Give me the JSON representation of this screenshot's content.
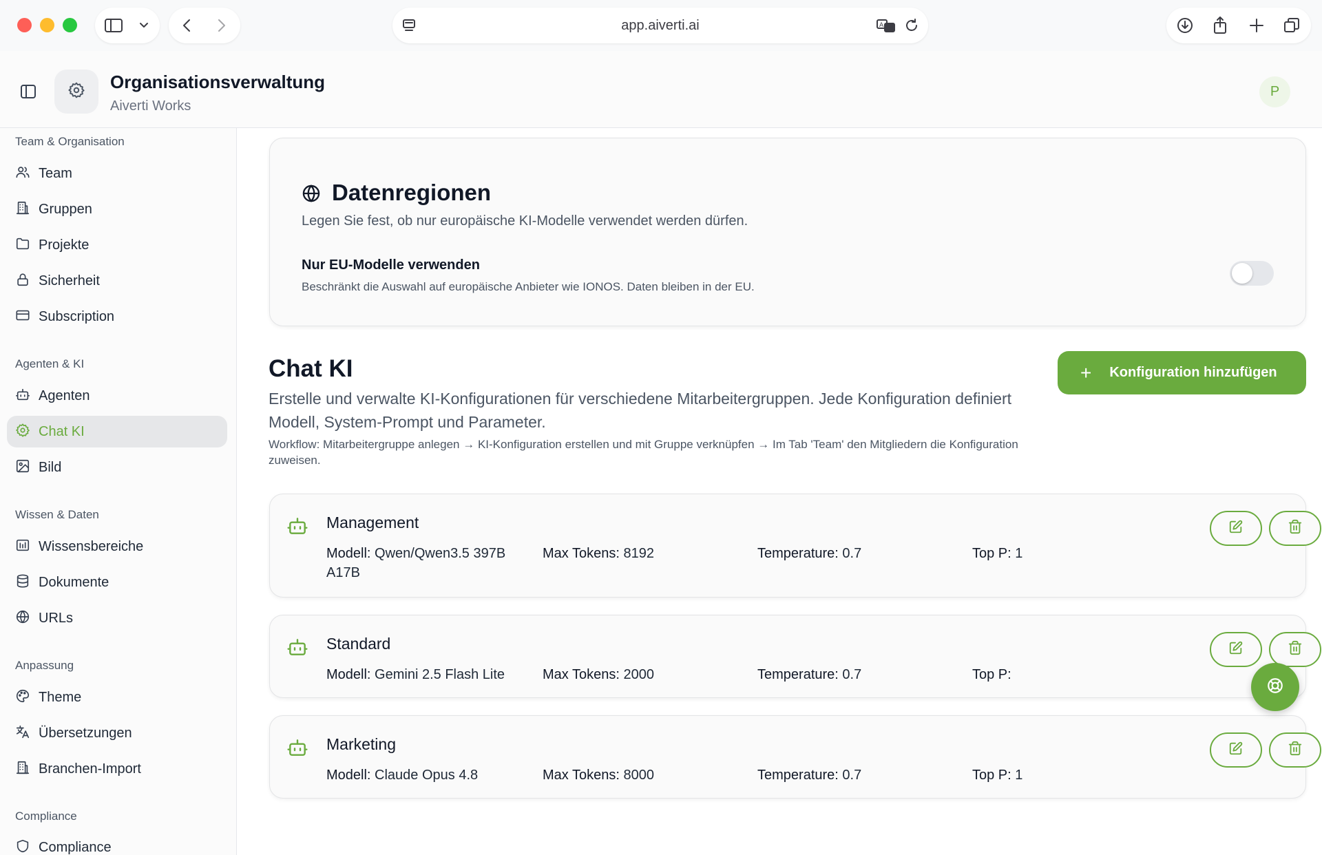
{
  "browser": {
    "url": "app.aiverti.ai"
  },
  "header": {
    "title": "Organisationsverwaltung",
    "subtitle": "Aiverti Works",
    "avatar_initial": "P"
  },
  "sidebar": {
    "sections": [
      {
        "label": "Team & Organisation"
      },
      {
        "label": "Agenten & KI"
      },
      {
        "label": "Wissen & Daten"
      },
      {
        "label": "Anpassung"
      },
      {
        "label": "Compliance"
      }
    ],
    "items": [
      {
        "label": "Team",
        "icon": "users-icon"
      },
      {
        "label": "Gruppen",
        "icon": "building-icon"
      },
      {
        "label": "Projekte",
        "icon": "folder-icon"
      },
      {
        "label": "Sicherheit",
        "icon": "lock-icon"
      },
      {
        "label": "Subscription",
        "icon": "credit-card-icon"
      },
      {
        "label": "Agenten",
        "icon": "bot-icon"
      },
      {
        "label": "Chat KI",
        "icon": "gear-icon",
        "active": true
      },
      {
        "label": "Bild",
        "icon": "image-icon"
      },
      {
        "label": "Wissensbereiche",
        "icon": "library-icon"
      },
      {
        "label": "Dokumente",
        "icon": "database-icon"
      },
      {
        "label": "URLs",
        "icon": "globe-icon"
      },
      {
        "label": "Theme",
        "icon": "palette-icon"
      },
      {
        "label": "Übersetzungen",
        "icon": "translate-icon"
      },
      {
        "label": "Branchen-Import",
        "icon": "building-icon"
      },
      {
        "label": "Compliance",
        "icon": "shield-icon"
      }
    ]
  },
  "data_regions": {
    "title": "Datenregionen",
    "description": "Legen Sie fest, ob nur europäische KI-Modelle verwendet werden dürfen.",
    "option_title": "Nur EU-Modelle verwenden",
    "option_description": "Beschränkt die Auswahl auf europäische Anbieter wie IONOS. Daten bleiben in der EU.",
    "eu_only_enabled": false
  },
  "chat_ki": {
    "title": "Chat KI",
    "description": "Erstelle und verwalte KI-Konfigurationen für verschiedene Mitarbeitergruppen. Jede Konfiguration definiert Modell, System-Prompt und Parameter.",
    "workflow": "Workflow: Mitarbeitergruppe anlegen → KI-Konfiguration erstellen und mit Gruppe verknüpfen → Im Tab 'Team' den Mitgliedern die Konfiguration zuweisen.",
    "add_button": "Konfiguration hinzufügen",
    "labels": {
      "model": "Modell:",
      "max_tokens": "Max Tokens:",
      "temperature": "Temperature:",
      "top_p": "Top P:"
    },
    "configs": [
      {
        "name": "Management",
        "model": "Qwen/Qwen3.5 397B A17B",
        "max_tokens": "8192",
        "temperature": "0.7",
        "top_p": "1"
      },
      {
        "name": "Standard",
        "model": "Gemini 2.5 Flash Lite",
        "max_tokens": "2000",
        "temperature": "0.7",
        "top_p": ""
      },
      {
        "name": "Marketing",
        "model": "Claude Opus 4.8",
        "max_tokens": "8000",
        "temperature": "0.7",
        "top_p": "1"
      }
    ]
  },
  "colors": {
    "accent": "#6aab3e",
    "active_bg": "#e6e7e9"
  }
}
